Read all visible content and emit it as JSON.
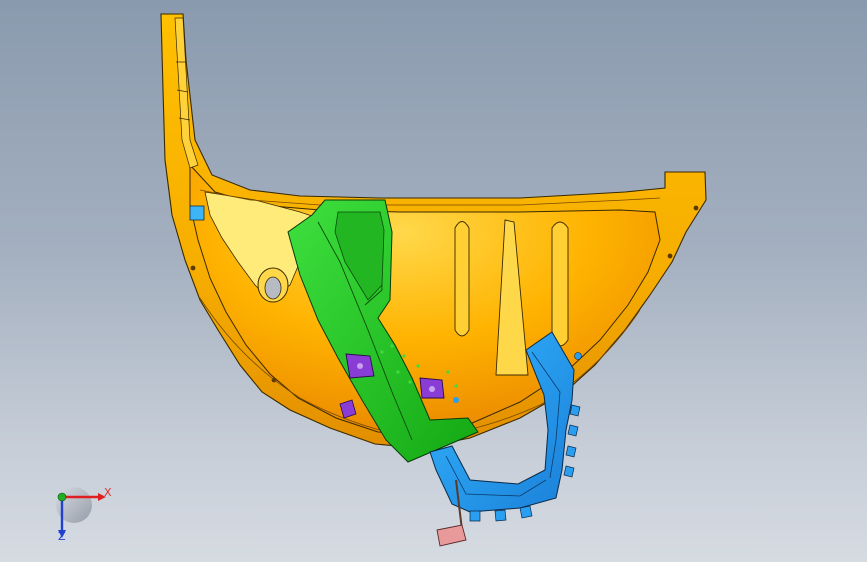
{
  "viewport": {
    "background_top": "#8a9aae",
    "background_bottom": "#d6dbe2"
  },
  "colors": {
    "housing": "#f5b400",
    "housing_shade": "#e08a00",
    "housing_light": "#ffe680",
    "edge": "#3a2a00",
    "bracket_green": "#1fc21f",
    "bracket_blue": "#2a9ef0",
    "clip_purple": "#8a3cd6",
    "pad_pink": "#e89a9a"
  },
  "triad": {
    "x_label": "X",
    "z_label": "Z",
    "icon": "axis-triad-icon"
  }
}
